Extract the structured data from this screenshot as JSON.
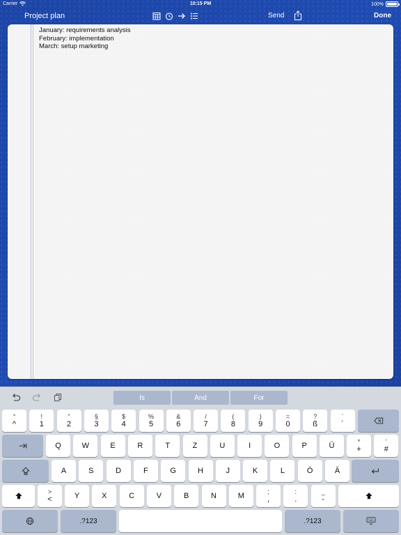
{
  "status_bar": {
    "carrier": "Carrier",
    "time": "10:15 PM",
    "battery": "100%"
  },
  "nav": {
    "title": "Project plan",
    "send_label": "Send",
    "done_label": "Done"
  },
  "note": {
    "lines": [
      "January: requirements analysis",
      "February: implementation",
      "March: setup marketing"
    ]
  },
  "keyboard": {
    "suggestions": [
      "Is",
      "And",
      "For"
    ],
    "number_row": [
      {
        "top": "°",
        "bot": "^"
      },
      {
        "top": "!",
        "bot": "1"
      },
      {
        "top": "\"",
        "bot": "2"
      },
      {
        "top": "§",
        "bot": "3"
      },
      {
        "top": "$",
        "bot": "4"
      },
      {
        "top": "%",
        "bot": "5"
      },
      {
        "top": "&",
        "bot": "6"
      },
      {
        "top": "/",
        "bot": "7"
      },
      {
        "top": "(",
        "bot": "8"
      },
      {
        "top": ")",
        "bot": "9"
      },
      {
        "top": "=",
        "bot": "0"
      },
      {
        "top": "?",
        "bot": "ß"
      },
      {
        "top": "`",
        "bot": "´"
      }
    ],
    "row_q": [
      "Q",
      "W",
      "E",
      "R",
      "T",
      "Z",
      "U",
      "I",
      "O",
      "P",
      "Ü"
    ],
    "row_q_extra": [
      {
        "top": "*",
        "bot": "+"
      },
      {
        "top": "’",
        "bot": "#"
      }
    ],
    "row_a": [
      "A",
      "S",
      "D",
      "F",
      "G",
      "H",
      "J",
      "K",
      "L",
      "Ö",
      "Ä"
    ],
    "row_y_first": {
      "top": ">",
      "bot": "<"
    },
    "row_y": [
      "Y",
      "X",
      "C",
      "V",
      "B",
      "N",
      "M"
    ],
    "row_y_extra": [
      {
        "top": ";",
        "bot": ","
      },
      {
        "top": ":",
        "bot": "."
      },
      {
        "top": "_",
        "bot": "-"
      }
    ],
    "numbers_label": ".?123"
  }
}
